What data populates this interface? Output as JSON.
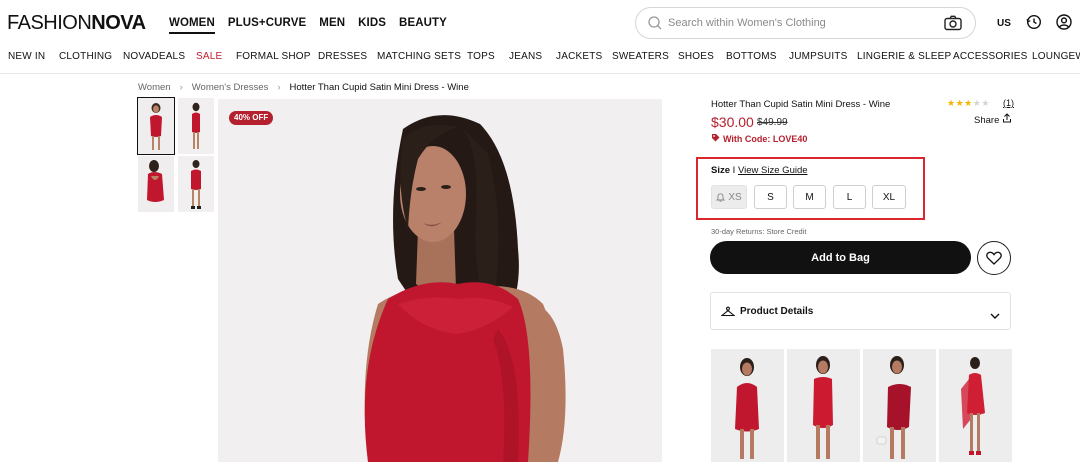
{
  "header": {
    "logo_part1": "FASHION",
    "logo_part2": "NOVA",
    "nav": [
      "WOMEN",
      "PLUS+CURVE",
      "MEN",
      "KIDS",
      "BEAUTY"
    ],
    "search_placeholder": "Search within Women's Clothing",
    "region": "US"
  },
  "categories": [
    "NEW IN",
    "CLOTHING",
    "NOVADEALS",
    "SALE",
    "FORMAL SHOP",
    "DRESSES",
    "MATCHING SETS",
    "TOPS",
    "JEANS",
    "JACKETS",
    "SWEATERS",
    "SHOES",
    "BOTTOMS",
    "JUMPSUITS",
    "LINGERIE & SLEEP",
    "ACCESSORIES",
    "LOUNGEWE"
  ],
  "breadcrumb": [
    "Women",
    "Women's Dresses",
    "Hotter Than Cupid Satin Mini Dress - Wine"
  ],
  "product": {
    "badge": "40% OFF",
    "title": "Hotter Than Cupid Satin Mini Dress - Wine",
    "rating": 3,
    "rating_max": 5,
    "review_count": "(1)",
    "share_label": "Share",
    "price": "$30.00",
    "old_price": "$49.99",
    "code_text": "With Code: LOVE40",
    "size_label": "Size",
    "size_separator": "I",
    "size_guide": "View Size Guide",
    "sizes": [
      "XS",
      "S",
      "M",
      "L",
      "XL"
    ],
    "returns_text": "30-day Returns: Store Credit",
    "add_to_bag": "Add to Bag",
    "details_label": "Product Details"
  },
  "colors": {
    "accent": "#b5202e",
    "highlight_box": "#d9272e",
    "dress": "#c0172e",
    "button": "#111111"
  }
}
